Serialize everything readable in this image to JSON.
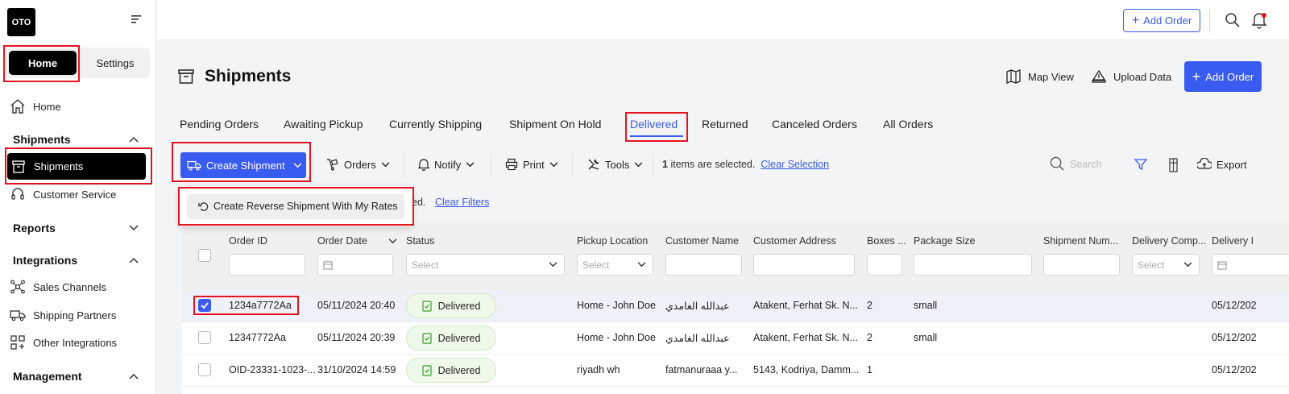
{
  "sidebar": {
    "logo": "OTO",
    "segment": {
      "home": "Home",
      "settings": "Settings"
    },
    "home_item": "Home",
    "sections": {
      "shipments": "Shipments",
      "reports": "Reports",
      "integrations": "Integrations",
      "management": "Management"
    },
    "items": {
      "shipments": "Shipments",
      "customer_service": "Customer Service",
      "sales_channels": "Sales Channels",
      "shipping_partners": "Shipping Partners",
      "other_integrations": "Other Integrations"
    }
  },
  "topbar": {
    "add_order": "Add Order"
  },
  "header": {
    "title": "Shipments",
    "map_view": "Map View",
    "upload_data": "Upload Data",
    "add_order": "Add Order"
  },
  "tabs": [
    "Pending Orders",
    "Awaiting Pickup",
    "Currently Shipping",
    "Shipment On Hold",
    "Delivered",
    "Returned",
    "Canceled Orders",
    "All Orders"
  ],
  "active_tab": "Delivered",
  "toolbar": {
    "create_shipment": "Create Shipment",
    "orders": "Orders",
    "notify": "Notify",
    "print": "Print",
    "tools": "Tools",
    "selected_count": "1",
    "selected_suffix": "items are selected.",
    "clear_selection": "Clear Selection",
    "search_placeholder": "Search",
    "export": "Export"
  },
  "dropdown": {
    "item": "Create Reverse Shipment With My Rates",
    "behind_text": "ed.",
    "clear_filters": "Clear Filters"
  },
  "table": {
    "columns": [
      "Order ID",
      "Order Date",
      "Status",
      "Pickup Location",
      "Customer Name",
      "Customer Address",
      "Boxes ...",
      "Package Size",
      "Shipment Num...",
      "Delivery Comp...",
      "Delivery I"
    ],
    "select_placeholder": "Select",
    "rows": [
      {
        "id": "1234a7772Aa",
        "date": "05/11/2024 20:40",
        "status": "Delivered",
        "pickup": "Home - John Doe",
        "customer": "عبدالله الغامدي",
        "address": "Atakent, Ferhat Sk. N...",
        "boxes": "2",
        "size": "small",
        "delivery": "05/12/202",
        "selected": true
      },
      {
        "id": "12347772Aa",
        "date": "05/11/2024 20:39",
        "status": "Delivered",
        "pickup": "Home - John Doe",
        "customer": "عبدالله الغامدي",
        "address": "Atakent, Ferhat Sk. N...",
        "boxes": "2",
        "size": "small",
        "delivery": "05/12/202",
        "selected": false
      },
      {
        "id": "OID-23331-1023-...",
        "date": "31/10/2024 14:59",
        "status": "Delivered",
        "pickup": "riyadh wh",
        "customer": "fatmanuraaa y...",
        "address": "5143, Kodriya, Damm...",
        "boxes": "1",
        "size": "",
        "delivery": "05/12/202",
        "selected": false
      }
    ]
  },
  "colors": {
    "accent": "#3a5bf0",
    "highlight": "#e3141f",
    "badge_bg": "#eef9e9"
  }
}
